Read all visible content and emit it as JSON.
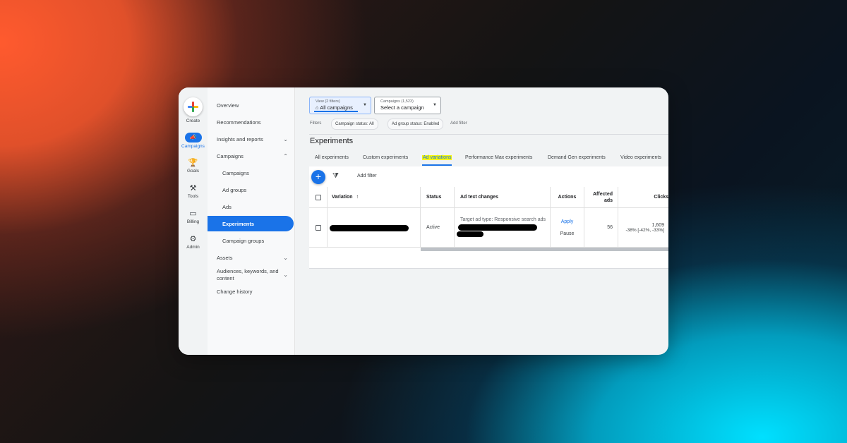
{
  "rail": {
    "create_label": "Create",
    "items": [
      {
        "label": "Campaigns",
        "icon": "megaphone-icon"
      },
      {
        "label": "Goals",
        "icon": "trophy-icon"
      },
      {
        "label": "Tools",
        "icon": "tools-icon"
      },
      {
        "label": "Billing",
        "icon": "credit-card-icon"
      },
      {
        "label": "Admin",
        "icon": "gear-icon"
      }
    ]
  },
  "nav": {
    "items": [
      {
        "label": "Overview"
      },
      {
        "label": "Recommendations"
      },
      {
        "label": "Insights and reports"
      },
      {
        "label": "Campaigns"
      },
      {
        "label": "Campaigns"
      },
      {
        "label": "Ad groups"
      },
      {
        "label": "Ads"
      },
      {
        "label": "Experiments"
      },
      {
        "label": "Campaign groups"
      },
      {
        "label": "Assets"
      },
      {
        "label": "Audiences, keywords, and content"
      },
      {
        "label": "Change history"
      }
    ]
  },
  "header": {
    "view_small": "View (2 filters)",
    "view_value": "All campaigns",
    "campaign_small": "Campaigns (1,523)",
    "campaign_value": "Select a campaign"
  },
  "filters": {
    "label": "Filters",
    "chips": [
      "Campaign status: All",
      "Ad group status: Enabled"
    ],
    "add": "Add filter"
  },
  "page_title": "Experiments",
  "tabs": [
    "All experiments",
    "Custom experiments",
    "Ad variations",
    "Performance Max experiments",
    "Demand Gen experiments",
    "Video experiments"
  ],
  "toolbar": {
    "add_filter": "Add filter"
  },
  "table": {
    "columns": {
      "variation": "Variation",
      "status": "Status",
      "ad_text_changes": "Ad text changes",
      "actions": "Actions",
      "affected_ads": "Affected ads",
      "clicks": "Clicks"
    },
    "row": {
      "status": "Active",
      "ad_text": "Target ad type: Responsive search ads",
      "apply": "Apply",
      "pause": "Pause",
      "affected": "56",
      "clicks_value": "1,609",
      "clicks_change": "-38%  [-42%, -33%]"
    }
  },
  "colors": {
    "accent": "#1a73e8",
    "highlight": "#f8f70a"
  }
}
